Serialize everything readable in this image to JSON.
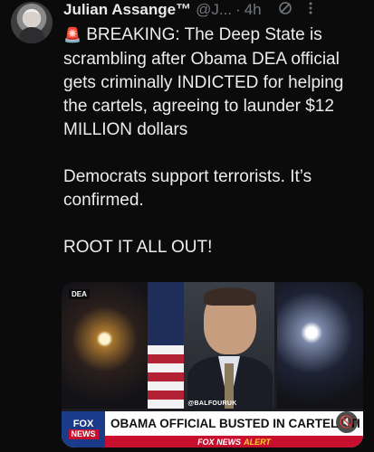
{
  "tweet": {
    "author_name": "Julian Assange™",
    "handle": "@J...",
    "separator": "·",
    "time": "4h",
    "siren_icon": "🚨",
    "text_line1": " BREAKING: The Deep State is scrambling after Obama DEA official gets criminally INDICTED for helping the cartels, agreeing to launder $12 MILLION dollars",
    "text_line2": "Democrats support terrorists. It’s confirmed.",
    "text_line3": "ROOT IT ALL OUT!",
    "grok_icon": "grok-icon",
    "more_icon": "more-icon"
  },
  "media": {
    "corner_tag": "DEA",
    "source_credit": "@BALFOURUK",
    "fox_logo_top": "FOX",
    "fox_logo_bottom": "NEWS",
    "headline": "OBAMA OFFICIAL BUSTED IN CARTEL STI",
    "alert_brand": "FOX NEWS",
    "alert_word": "ALERT",
    "mute_icon": "🔇"
  }
}
